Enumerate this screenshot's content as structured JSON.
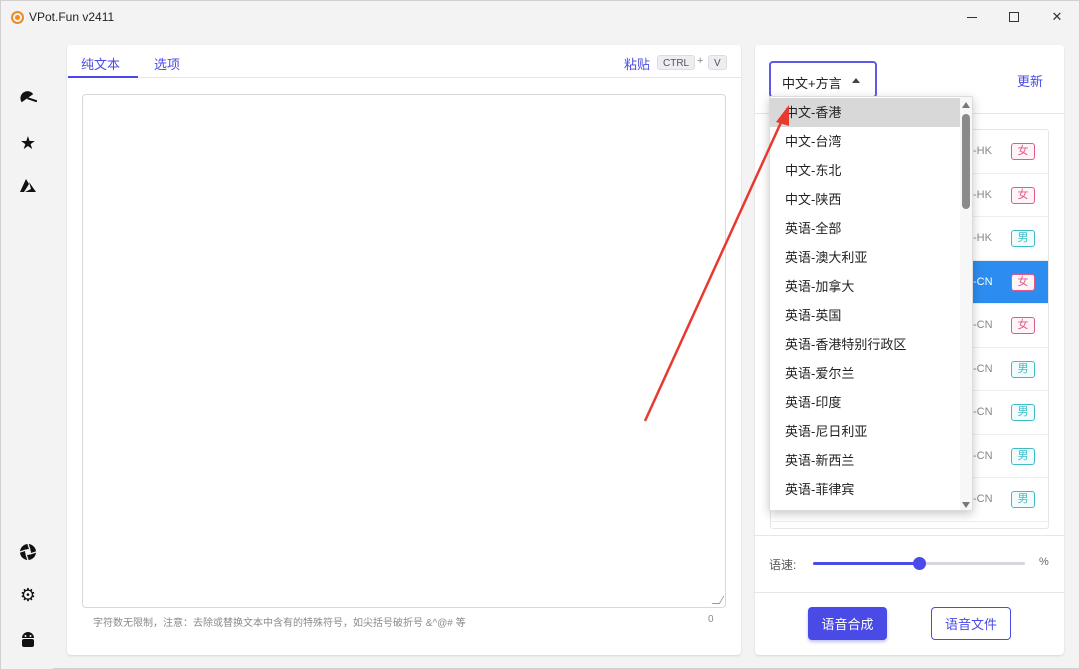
{
  "window": {
    "title": "VPot.Fun v2411"
  },
  "sidebar": {
    "items": [
      {
        "icon": "umbrella-icon"
      },
      {
        "icon": "star-icon"
      },
      {
        "icon": "azure-icon"
      },
      {
        "icon": "aperture-icon"
      },
      {
        "icon": "gear-icon"
      },
      {
        "icon": "android-icon"
      }
    ]
  },
  "editor": {
    "tabs": [
      "纯文本",
      "选项"
    ],
    "paste_label": "粘贴",
    "shortcut_ctrl": "CTRL",
    "shortcut_plus": "+",
    "shortcut_key": "V",
    "hint": "字符数无限制，注意：去除或替换文本中含有的特殊符号，如尖括号破折号 &^@# 等",
    "char_count": "0"
  },
  "voice_panel": {
    "language_select": "中文+方言",
    "update_label": "更新",
    "voices": [
      {
        "code": "-HK",
        "gender": "女"
      },
      {
        "code": "-HK",
        "gender": "女"
      },
      {
        "code": "-HK",
        "gender": "男"
      },
      {
        "code": "-CN",
        "gender": "女"
      },
      {
        "code": "-CN",
        "gender": "女"
      },
      {
        "code": "-CN",
        "gender": "男"
      },
      {
        "code": "-CN",
        "gender": "男"
      },
      {
        "code": "-CN",
        "gender": "男"
      },
      {
        "code": "-CN",
        "gender": "男"
      }
    ],
    "speed_label": "语速:",
    "speed_unit": "%",
    "speed_level": 0.5,
    "synthesize_button": "语音合成",
    "file_button": "语音文件"
  },
  "dropdown": {
    "options": [
      "中文-香港",
      "中文-台湾",
      "中文-东北",
      "中文-陕西",
      "英语-全部",
      "英语-澳大利亚",
      "英语-加拿大",
      "英语-英国",
      "英语-香港特别行政区",
      "英语-爱尔兰",
      "英语-印度",
      "英语-尼日利亚",
      "英语-新西兰",
      "英语-菲律宾"
    ]
  },
  "colors": {
    "accent": "#4a4ae6",
    "selected_row": "#2d8cf0",
    "annotation_arrow": "#e8392f"
  }
}
